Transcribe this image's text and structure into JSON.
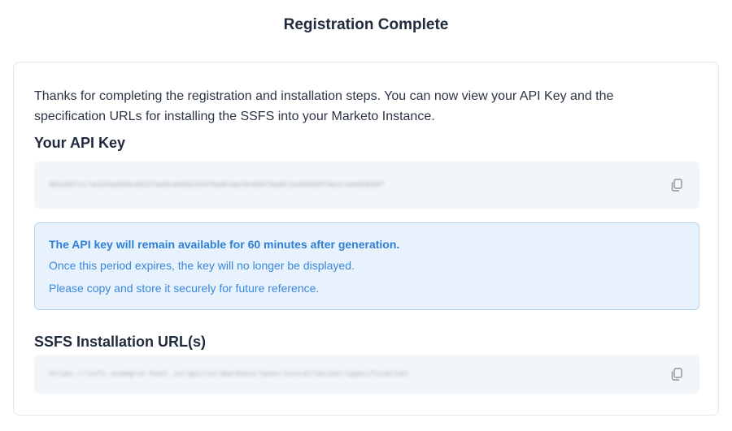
{
  "page": {
    "title": "Registration Complete"
  },
  "intro": "Thanks for completing the registration and installation steps. You can now view your API Key and the specification URLs for installing the SSFS into your Marketo Instance.",
  "api_key": {
    "heading": "Your API Key",
    "value": "9b3a0f1c7e2d4a6b8c0e2f4a6c8e0b2d4f6a8c0e2b4d6f8a0c2e4b6d8f0a2c4e6b8d0f",
    "copy_icon": "copy-icon"
  },
  "alert": {
    "title": "The API key will remain available for 60 minutes after generation.",
    "line1": "Once this period expires, the key will no longer be displayed.",
    "line2": "Please copy and store it securely for future reference."
  },
  "ssfs": {
    "heading": "SSFS Installation URL(s)",
    "value": "https://ssfs.example-host.io/api/v1/marketo/spec/installation/specification",
    "copy_icon": "copy-icon"
  },
  "colors": {
    "accent": "#2f7fd6",
    "alert_bg": "#e8f2fd",
    "field_bg": "#f3f6f9"
  }
}
